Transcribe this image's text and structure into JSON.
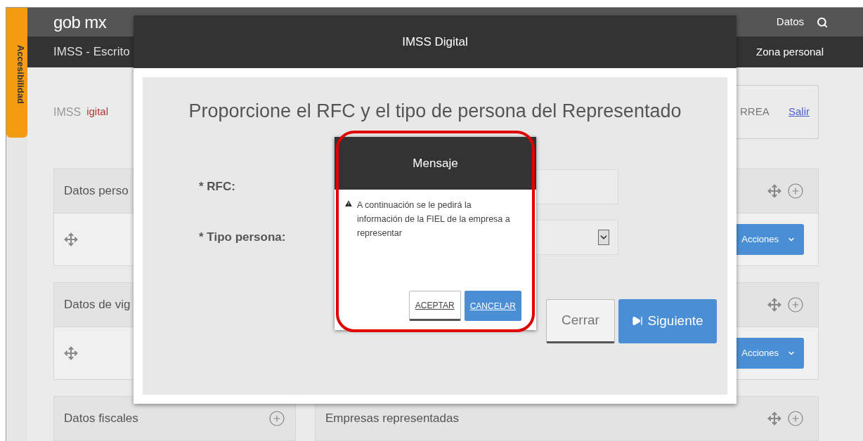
{
  "accessibility_tab": {
    "label": "Accesibilidad"
  },
  "header": {
    "logo": "gob mx",
    "links": [
      "Datos"
    ]
  },
  "nav": {
    "title": "IMSS - Escrito",
    "links": [
      "Zona personal"
    ]
  },
  "brand": {
    "logo_left": "IMSS",
    "logo_right": "igital"
  },
  "user_box": {
    "name": "RREA",
    "logout": "Salir"
  },
  "left_panels": [
    {
      "title": "Datos perso",
      "has_body": true
    },
    {
      "title": "Datos de vig",
      "has_body": true
    },
    {
      "title": "Datos fiscales",
      "has_body": false
    }
  ],
  "right_panels": [
    {
      "action": "Acciones"
    },
    {
      "action": "Acciones"
    },
    {
      "title": "Empresas representadas"
    }
  ],
  "modal": {
    "title": "IMSS Digital",
    "heading": "Proporcione el RFC y el tipo de persona del Representado",
    "fields": [
      {
        "label": "* RFC:",
        "kind": "text"
      },
      {
        "label": "* Tipo persona:",
        "kind": "select"
      }
    ],
    "buttons": [
      {
        "label": "Cerrar",
        "primary": false
      },
      {
        "label": "Siguiente",
        "primary": true
      }
    ]
  },
  "message": {
    "title": "Mensaje",
    "text": "A continuación se le pedirá la información de la FIEL de la empresa a representar",
    "highlighted": true,
    "buttons": [
      {
        "label": "ACEPTAR",
        "primary": false
      },
      {
        "label": "CANCELAR",
        "primary": true
      }
    ]
  }
}
